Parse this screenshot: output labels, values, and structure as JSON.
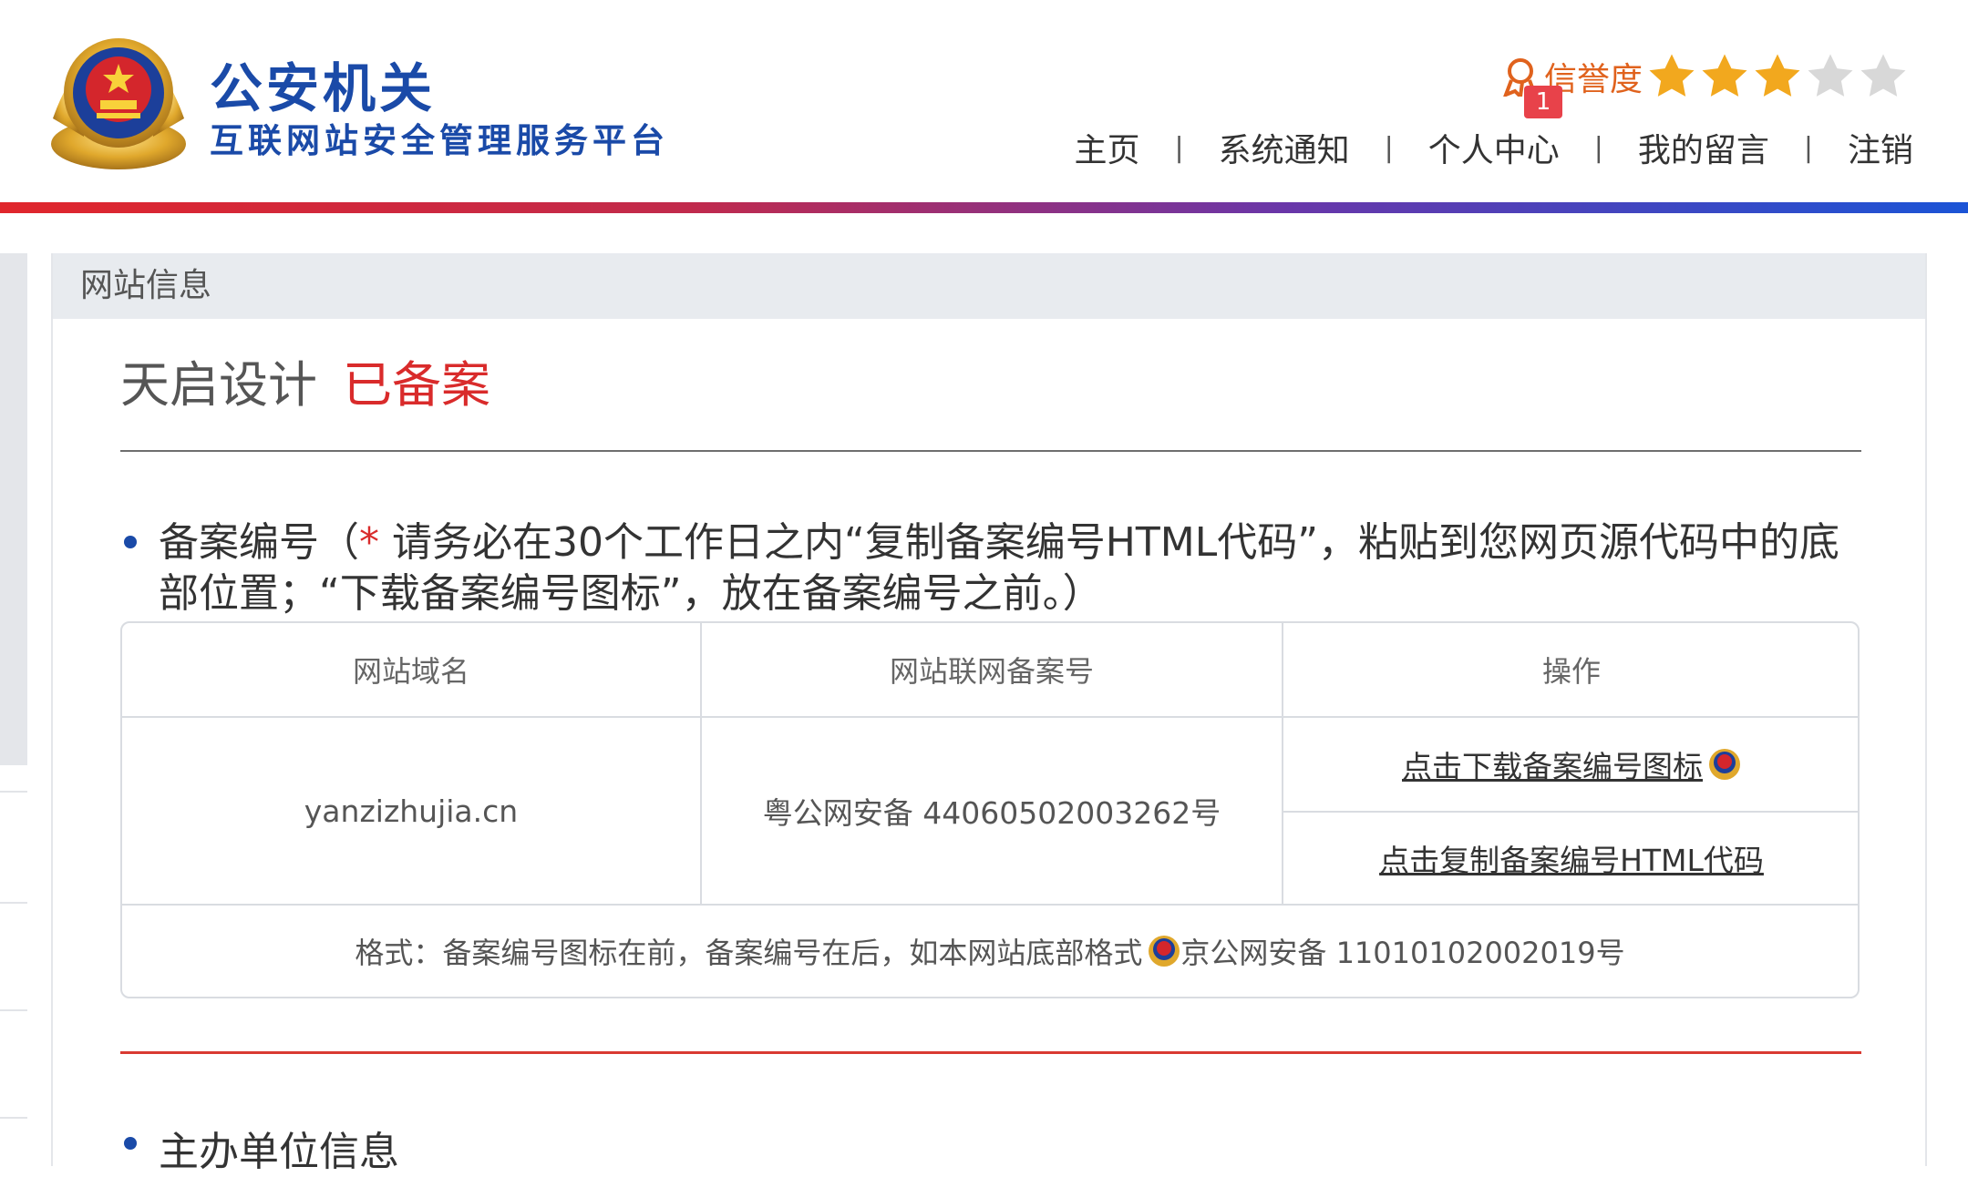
{
  "header": {
    "brand_title": "公安机关",
    "brand_subtitle": "互联网站安全管理服务平台",
    "credit_label": "信誉度",
    "credit_rating": 3,
    "credit_max": 5,
    "notification_count": "1",
    "nav": [
      {
        "label": "主页"
      },
      {
        "label": "系统通知"
      },
      {
        "label": "个人中心"
      },
      {
        "label": "我的留言"
      },
      {
        "label": "注销"
      }
    ],
    "nav_separator": "|"
  },
  "panel": {
    "heading": "网站信息",
    "site_name": "天启设计",
    "site_status": "已备案",
    "filing_section": {
      "title": "备案编号（",
      "required_mark": "*",
      "instruction": " 请务必在30个工作日之内“复制备案编号HTML代码”，粘贴到您网页源代码中的底部位置；“下载备案编号图标”，放在备案编号之前。）"
    },
    "table": {
      "headers": [
        "网站域名",
        "网站联网备案号",
        "操作"
      ],
      "domain": "yanzizhujia.cn",
      "filing_number": "粤公网安备 44060502003262号",
      "actions": {
        "download_icon": "点击下载备案编号图标",
        "copy_html": "点击复制备案编号HTML代码"
      },
      "format_note": "格式：备案编号图标在前，备案编号在后，如本网站底部格式",
      "format_example": "京公网安备 11010102002019号"
    },
    "section2_title": "主办单位信息"
  },
  "colors": {
    "brand_blue": "#1a4aa8",
    "status_red": "#d92b2b",
    "credit_orange": "#e0621d",
    "star_gold": "#f2a81e",
    "star_empty": "#d8d8d8"
  },
  "icons": {
    "emblem": "police-emblem-icon",
    "credit": "award-icon",
    "star": "star-icon"
  }
}
